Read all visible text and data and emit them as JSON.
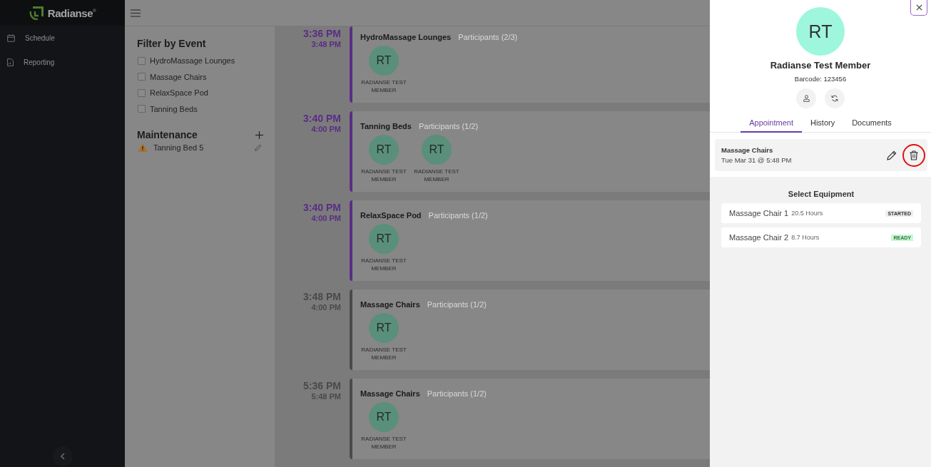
{
  "sidebar": {
    "logo": "Radianse$^{®}$",
    "items": [
      {
        "label": "Schedule"
      },
      {
        "label": "Reporting"
      }
    ]
  },
  "filter": {
    "title": "Filter by Event",
    "options": [
      {
        "label": "HydroMassage Lounges",
        "checked": false
      },
      {
        "label": "Massage Chairs",
        "checked": false
      },
      {
        "label": "RelaxSpace Pod",
        "checked": false
      },
      {
        "label": "Tanning Beds",
        "checked": false
      }
    ]
  },
  "maintenance": {
    "title": "Maintenance",
    "items": [
      {
        "label": "Tanning Bed 5"
      }
    ]
  },
  "schedule": [
    {
      "start": "3:36 PM",
      "end": "3:48 PM",
      "color": "#5b2d86",
      "title": "HydroMassage Lounges",
      "participants_label": "Participants (2/3)",
      "participants": [
        {
          "initials": "RT",
          "name": "RADIANSE TEST MEMBER"
        }
      ]
    },
    {
      "start": "3:40 PM",
      "end": "4:00 PM",
      "color": "#5b2d86",
      "title": "Tanning Beds",
      "participants_label": "Participants (1/2)",
      "participants": [
        {
          "initials": "RT",
          "name": "RADIANSE TEST MEMBER"
        },
        {
          "initials": "RT",
          "name": "RADIANSE TEST MEMBER"
        }
      ]
    },
    {
      "start": "3:40 PM",
      "end": "4:00 PM",
      "color": "#5b2d86",
      "title": "RelaxSpace Pod",
      "participants_label": "Participants (1/2)",
      "participants": [
        {
          "initials": "RT",
          "name": "RADIANSE TEST MEMBER"
        }
      ]
    },
    {
      "start": "3:48 PM",
      "end": "4:00 PM",
      "color": "#4a4a4a",
      "title": "Massage Chairs",
      "participants_label": "Participants (1/2)",
      "participants": [
        {
          "initials": "RT",
          "name": "RADIANSE TEST MEMBER"
        }
      ]
    },
    {
      "start": "5:36 PM",
      "end": "5:48 PM",
      "color": "#4a4a4a",
      "title": "Massage Chairs",
      "participants_label": "Participants (1/2)",
      "participants": [
        {
          "initials": "RT",
          "name": "RADIANSE TEST MEMBER"
        }
      ]
    }
  ],
  "member_panel": {
    "initials": "RT",
    "name": "Radianse Test Member",
    "barcode": "Barcode: 123456",
    "tabs": [
      {
        "label": "Appointment",
        "selected": true
      },
      {
        "label": "History",
        "selected": false
      },
      {
        "label": "Documents",
        "selected": false
      }
    ],
    "appointment": {
      "title": "Massage Chairs",
      "when": "Tue Mar 31 @ 5:48 PM"
    },
    "equipment": {
      "title": "Select Equipment",
      "items": [
        {
          "name": "Massage Chair 1",
          "hours": "20.5 Hours",
          "status": "STARTED",
          "kind": "started"
        },
        {
          "name": "Massage Chair 2",
          "hours": "8.7 Hours",
          "status": "READY",
          "kind": "ready"
        }
      ]
    }
  }
}
